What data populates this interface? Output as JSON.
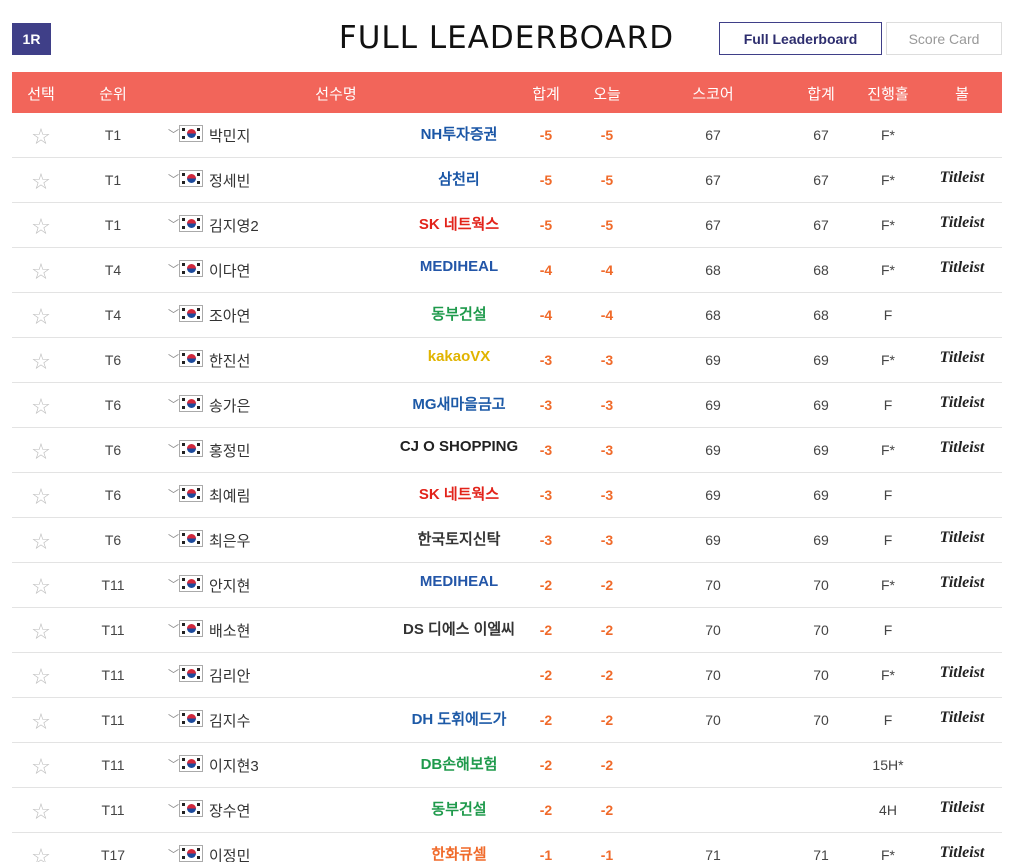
{
  "round_badge": "1R",
  "title": "FULL LEADERBOARD",
  "buttons": {
    "full_leaderboard": "Full Leaderboard",
    "score_card": "Score Card"
  },
  "headers": {
    "select": "선택",
    "rank": "순위",
    "player": "선수명",
    "total": "합계",
    "today": "오늘",
    "score": "스코어",
    "total2": "합계",
    "hole": "진행홀",
    "ball": "볼"
  },
  "colors": {
    "header_bg": "#f2655a",
    "badge_bg": "#3f3f88",
    "score_orange": "#f06a2a"
  },
  "rows": [
    {
      "rank": "T1",
      "name": "박민지",
      "sponsor": "NH투자증권",
      "sponsor_color": "#1a56a6",
      "total": "-5",
      "today": "-5",
      "score": "67",
      "total2": "67",
      "hole": "F*",
      "ball": ""
    },
    {
      "rank": "T1",
      "name": "정세빈",
      "sponsor": "삼천리",
      "sponsor_color": "#1a56a6",
      "total": "-5",
      "today": "-5",
      "score": "67",
      "total2": "67",
      "hole": "F*",
      "ball": "Titleist"
    },
    {
      "rank": "T1",
      "name": "김지영2",
      "sponsor": "SK 네트웍스",
      "sponsor_color": "#e2231a",
      "total": "-5",
      "today": "-5",
      "score": "67",
      "total2": "67",
      "hole": "F*",
      "ball": "Titleist"
    },
    {
      "rank": "T4",
      "name": "이다연",
      "sponsor": "MEDIHEAL",
      "sponsor_color": "#2356a8",
      "total": "-4",
      "today": "-4",
      "score": "68",
      "total2": "68",
      "hole": "F*",
      "ball": "Titleist"
    },
    {
      "rank": "T4",
      "name": "조아연",
      "sponsor": "동부건설",
      "sponsor_color": "#1f9a4c",
      "total": "-4",
      "today": "-4",
      "score": "68",
      "total2": "68",
      "hole": "F",
      "ball": ""
    },
    {
      "rank": "T6",
      "name": "한진선",
      "sponsor": "kakaoVX",
      "sponsor_color": "#e1b400",
      "total": "-3",
      "today": "-3",
      "score": "69",
      "total2": "69",
      "hole": "F*",
      "ball": "Titleist"
    },
    {
      "rank": "T6",
      "name": "송가은",
      "sponsor": "MG새마을금고",
      "sponsor_color": "#1d5aa7",
      "total": "-3",
      "today": "-3",
      "score": "69",
      "total2": "69",
      "hole": "F",
      "ball": "Titleist"
    },
    {
      "rank": "T6",
      "name": "홍정민",
      "sponsor": "CJ O SHOPPING",
      "sponsor_color": "#222222",
      "total": "-3",
      "today": "-3",
      "score": "69",
      "total2": "69",
      "hole": "F*",
      "ball": "Titleist"
    },
    {
      "rank": "T6",
      "name": "최예림",
      "sponsor": "SK 네트웍스",
      "sponsor_color": "#e2231a",
      "total": "-3",
      "today": "-3",
      "score": "69",
      "total2": "69",
      "hole": "F",
      "ball": ""
    },
    {
      "rank": "T6",
      "name": "최은우",
      "sponsor": "한국토지신탁",
      "sponsor_color": "#333333",
      "total": "-3",
      "today": "-3",
      "score": "69",
      "total2": "69",
      "hole": "F",
      "ball": "Titleist"
    },
    {
      "rank": "T11",
      "name": "안지현",
      "sponsor": "MEDIHEAL",
      "sponsor_color": "#2356a8",
      "total": "-2",
      "today": "-2",
      "score": "70",
      "total2": "70",
      "hole": "F*",
      "ball": "Titleist"
    },
    {
      "rank": "T11",
      "name": "배소현",
      "sponsor": "DS 디에스 이엘씨",
      "sponsor_color": "#333333",
      "total": "-2",
      "today": "-2",
      "score": "70",
      "total2": "70",
      "hole": "F",
      "ball": ""
    },
    {
      "rank": "T11",
      "name": "김리안",
      "sponsor": "",
      "sponsor_color": "#333333",
      "total": "-2",
      "today": "-2",
      "score": "70",
      "total2": "70",
      "hole": "F*",
      "ball": "Titleist"
    },
    {
      "rank": "T11",
      "name": "김지수",
      "sponsor": "DH 도휘에드가",
      "sponsor_color": "#1d5aa7",
      "total": "-2",
      "today": "-2",
      "score": "70",
      "total2": "70",
      "hole": "F",
      "ball": "Titleist"
    },
    {
      "rank": "T11",
      "name": "이지현3",
      "sponsor": "DB손해보험",
      "sponsor_color": "#1f9a4c",
      "total": "-2",
      "today": "-2",
      "score": "",
      "total2": "",
      "hole": "15H*",
      "ball": ""
    },
    {
      "rank": "T11",
      "name": "장수연",
      "sponsor": "동부건설",
      "sponsor_color": "#1f9a4c",
      "total": "-2",
      "today": "-2",
      "score": "",
      "total2": "",
      "hole": "4H",
      "ball": "Titleist"
    },
    {
      "rank": "T17",
      "name": "이정민",
      "sponsor": "한화큐셀",
      "sponsor_color": "#f06a2a",
      "total": "-1",
      "today": "-1",
      "score": "71",
      "total2": "71",
      "hole": "F*",
      "ball": "Titleist"
    }
  ]
}
